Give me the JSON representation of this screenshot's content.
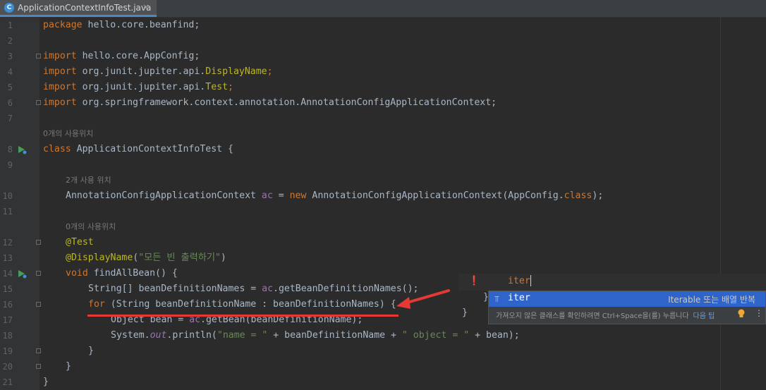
{
  "tab": {
    "title": "ApplicationContextInfoTest.java",
    "close": "×",
    "icon": "java-class-icon"
  },
  "gutter": {
    "line_numbers": [
      "1",
      "2",
      "3",
      "4",
      "5",
      "6",
      "7",
      "8",
      "9",
      "10",
      "11",
      "12",
      "13",
      "14",
      "15",
      "16",
      "17",
      "18",
      "19",
      "20",
      "21"
    ]
  },
  "code": {
    "l1": {
      "kw": "package",
      "rest": " hello.core.beanfind;"
    },
    "l3": {
      "kw": "import",
      "rest": " hello.core.AppConfig;"
    },
    "l4": {
      "kw": "import",
      "pre": " org.junit.jupiter.api.",
      "ann": "DisplayName",
      "end": ";"
    },
    "l5": {
      "kw": "import",
      "pre": " org.junit.jupiter.api.",
      "ann": "Test",
      "end": ";"
    },
    "l6": {
      "kw": "import",
      "rest": " org.springframework.context.annotation.AnnotationConfigApplicationContext;"
    },
    "hint_class": "0개의 사용위치",
    "l8": {
      "kw": "class",
      "rest": " ApplicationContextInfoTest {"
    },
    "hint_field": "2개 사용 위치",
    "l10": {
      "pre": "AnnotationConfigApplicationContext ",
      "var": "ac",
      "mid": " = ",
      "kw": "new",
      "post": " AnnotationConfigApplicationContext(AppConfig.",
      "kw2": "class",
      "end": ");"
    },
    "hint_method": "0개의 사용위치",
    "l12": {
      "ann": "@Test"
    },
    "l13": {
      "ann": "@DisplayName",
      "open": "(",
      "str": "\"모든 빈 출력하기\"",
      "close": ")"
    },
    "l14": {
      "kw": "void",
      "rest": " findAllBean() {"
    },
    "l15": {
      "pre": "String[] beanDefinitionNames = ",
      "var": "ac",
      "post": ".getBeanDefinitionNames();"
    },
    "l16": {
      "kw": "for",
      "rest": " (String beanDefinitionName : beanDefinitionNames) {"
    },
    "l17": {
      "pre": "Object bean = ",
      "var": "ac",
      "post": ".getBean(beanDefinitionName);"
    },
    "l18": {
      "pre": "System.",
      "fld": "out",
      "mid": ".println(",
      "str1": "\"name = \"",
      "mid2": " + beanDefinitionName + ",
      "str2": "\" object = \"",
      "end": " + bean);"
    },
    "l19": {
      "rest": "}"
    },
    "l20": {
      "rest": "}"
    },
    "l21": {
      "rest": "}"
    }
  },
  "autocomplete": {
    "typed": "iter",
    "item": {
      "icon": "live-template-icon",
      "name": "iter",
      "description": "Iterable 또는 배열 반복"
    },
    "footer": "가져오지 않은 클래스를 확인하려면 Ctrl+Space을(를) 누릅니다",
    "footer_link": "다음 팁",
    "more": "⋮"
  },
  "colors": {
    "keyword": "#cc7832",
    "string": "#6a8759",
    "annotation": "#bbb529",
    "field": "#9876aa",
    "selection": "#2f65ca"
  }
}
